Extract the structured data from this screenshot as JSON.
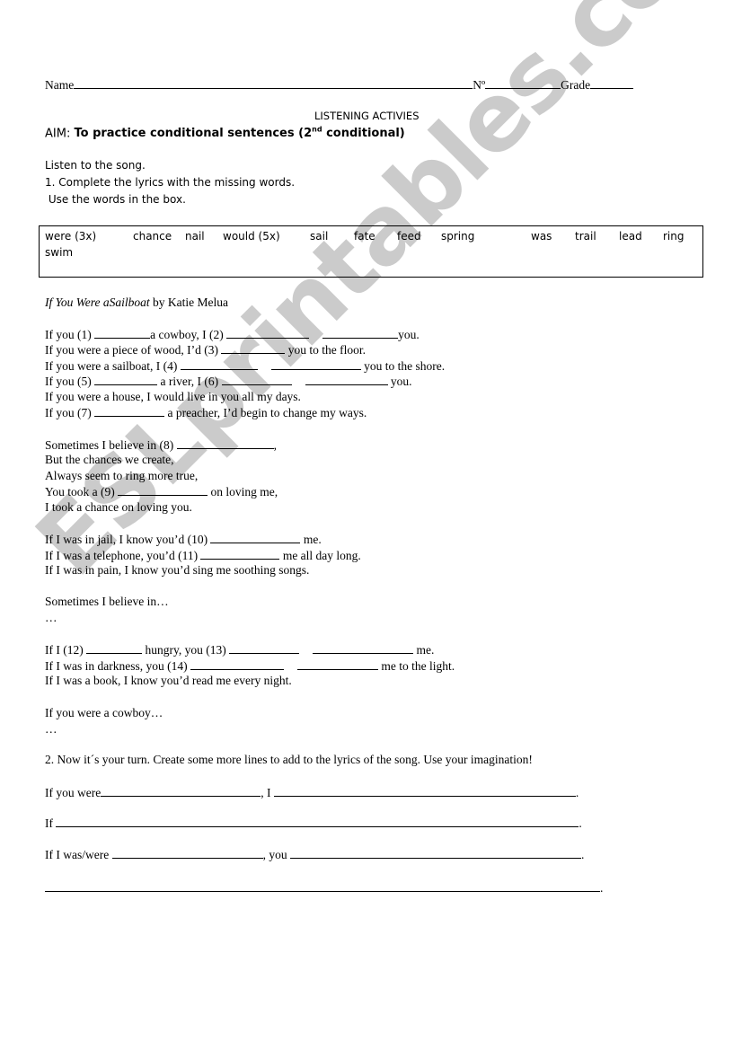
{
  "header": {
    "name_label": "Name",
    "number_label": "Nº",
    "grade_label": "Grade"
  },
  "title": "LISTENING ACTIVIES",
  "aim": {
    "label": "AIM: ",
    "text_before": "To practice conditional sentences (2",
    "superscript": "nd",
    "text_after": " conditional)"
  },
  "instructions": [
    "Listen to the song.",
    "1. Complete the lyrics with the missing words.",
    " Use the words in the box."
  ],
  "word_box": {
    "words": [
      "were (3x)",
      "chance",
      "nail",
      "would (5x)",
      "sail",
      "fate",
      "feed",
      "spring",
      "was",
      "trail",
      "lead",
      "ring",
      "swim"
    ]
  },
  "song": {
    "title": "If You Were aSailboat",
    "by": " by Katie Melua"
  },
  "lyrics": {
    "l1": [
      "If you (1) ",
      "a cowboy, I (2) ",
      "you."
    ],
    "l2": [
      "If you were a piece of wood, I’d (3) ",
      " you to the floor."
    ],
    "l3": [
      "If you were a sailboat, I (4) ",
      " you to the shore."
    ],
    "l4": [
      "If you (5) ",
      " a river, I (6) ",
      " you."
    ],
    "l5": "If you were a house, I would live in you all my days.",
    "l6": [
      "If you (7) ",
      " a preacher, I’d begin to change my ways."
    ],
    "l7": [
      "Sometimes I believe in (8) ",
      ","
    ],
    "l8": "But the chances we create,",
    "l9": "Always seem to ring more true,",
    "l10": [
      "You took a (9) ",
      " on loving me,"
    ],
    "l11": "I took a chance on loving you.",
    "l12": [
      "If I was in jail, I know you’d (10) ",
      " me."
    ],
    "l13": [
      "If I was a telephone, you’d (11) ",
      " me all day long."
    ],
    "l14": "If I was in pain, I know you’d sing me soothing songs.",
    "l15": "Sometimes I believe in…",
    "l16": "…",
    "l17": [
      "If I (12) ",
      " hungry, you (13) ",
      " me."
    ],
    "l18": [
      "If I was in darkness, you (14) ",
      " me to the light."
    ],
    "l19": "If I was a book, I know you’d read me every night.",
    "l20": "If you were a cowboy…",
    "l21": "…"
  },
  "task2": {
    "instruction": "2. Now it´s your turn. Create some more lines to add to the lyrics of the song. Use your imagination!",
    "line1": [
      "If you were",
      ", I ",
      "."
    ],
    "line2": [
      "If ",
      "."
    ],
    "line3": [
      "If I was/were ",
      ", you ",
      "."
    ],
    "line4": [
      "."
    ]
  },
  "watermark": "ESLprintables.com"
}
